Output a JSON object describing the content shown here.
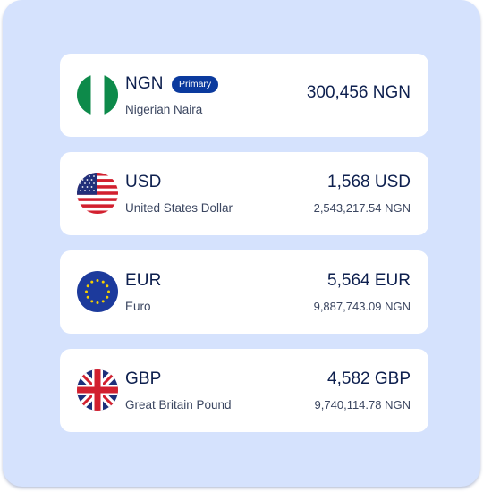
{
  "currencies": [
    {
      "code": "NGN",
      "name": "Nigerian Naira",
      "badge": "Primary",
      "amount": "300,456 NGN",
      "converted": "",
      "flag_icon": "nigeria-flag-icon"
    },
    {
      "code": "USD",
      "name": "United States Dollar",
      "amount": "1,568 USD",
      "converted": "2,543,217.54 NGN",
      "flag_icon": "usa-flag-icon"
    },
    {
      "code": "EUR",
      "name": "Euro",
      "amount": "5,564 EUR",
      "converted": "9,887,743.09 NGN",
      "flag_icon": "eu-flag-icon"
    },
    {
      "code": "GBP",
      "name": "Great Britain Pound",
      "amount": "4,582 GBP",
      "converted": "9,740,114.78 NGN",
      "flag_icon": "uk-flag-icon"
    }
  ],
  "colors": {
    "panel_bg": "#d5e2fd",
    "badge_bg": "#0b3a9e",
    "text_primary": "#0d1f4e",
    "text_secondary": "#3b4660"
  }
}
